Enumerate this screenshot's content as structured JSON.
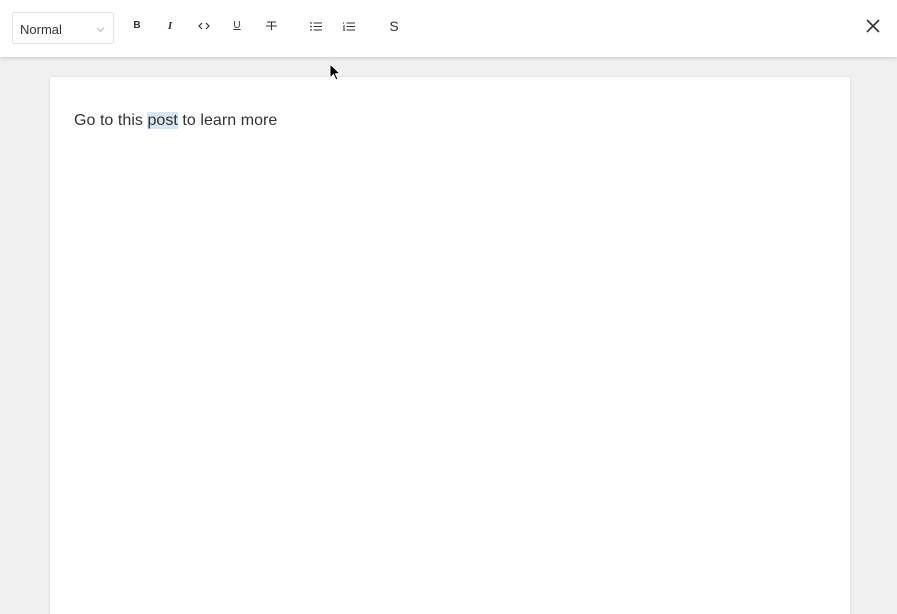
{
  "toolbar": {
    "block_type": "Normal",
    "buttons": {
      "bold": "B",
      "italic": "I",
      "underline": "U",
      "strike_s": "S"
    }
  },
  "editor": {
    "text_before": "Go to this ",
    "selected_text": "post",
    "text_after": " to learn more"
  },
  "icons": [
    "chevron-down-icon",
    "bold-icon",
    "italic-icon",
    "code-icon",
    "underline-icon",
    "strikethrough-icon",
    "bulleted-list-icon",
    "numbered-list-icon",
    "strike-s-icon",
    "close-icon",
    "mouse-cursor-icon"
  ]
}
